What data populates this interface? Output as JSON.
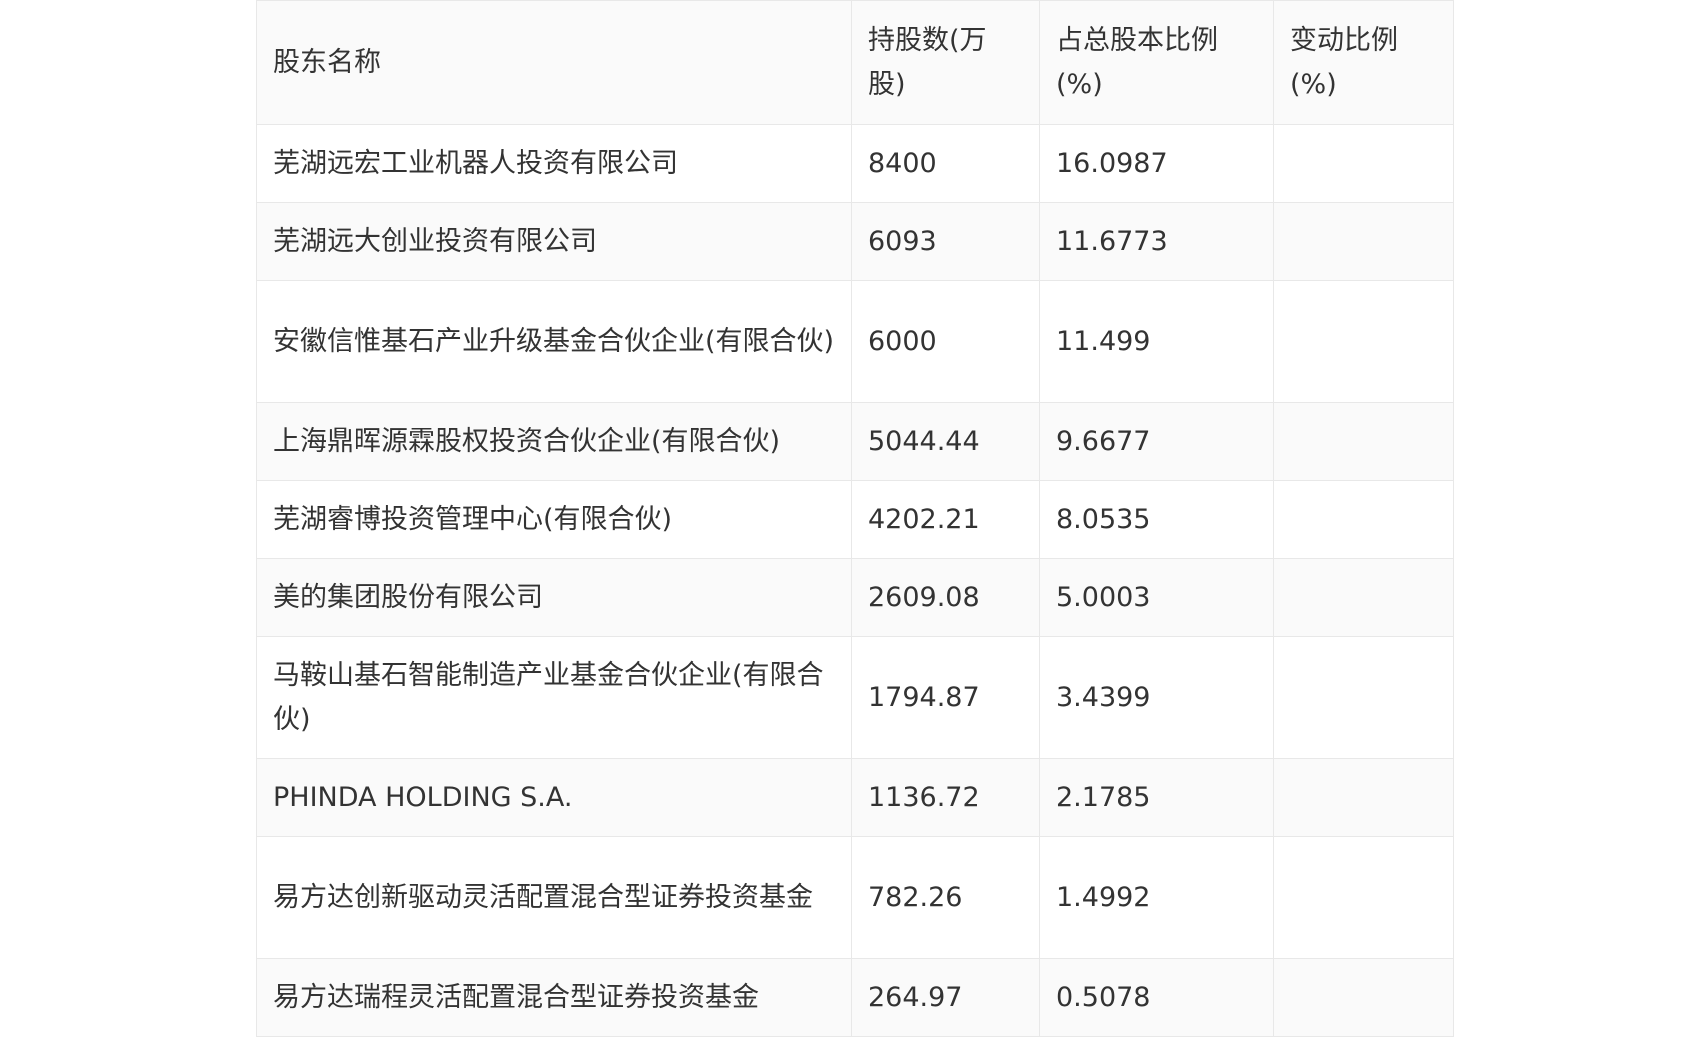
{
  "table": {
    "headers": [
      "股东名称",
      "持股数(万股)",
      "占总股本比例(%)",
      "变动比例(%)"
    ],
    "rows": [
      {
        "name": "芜湖远宏工业机器人投资有限公司",
        "shares": "8400",
        "ratio": "16.0987",
        "change": ""
      },
      {
        "name": "芜湖远大创业投资有限公司",
        "shares": "6093",
        "ratio": "11.6773",
        "change": ""
      },
      {
        "name": "安徽信惟基石产业升级基金合伙企业(有限合伙)",
        "shares": "6000",
        "ratio": "11.499",
        "change": ""
      },
      {
        "name": "上海鼎晖源霖股权投资合伙企业(有限合伙)",
        "shares": "5044.44",
        "ratio": "9.6677",
        "change": ""
      },
      {
        "name": "芜湖睿博投资管理中心(有限合伙)",
        "shares": "4202.21",
        "ratio": "8.0535",
        "change": ""
      },
      {
        "name": "美的集团股份有限公司",
        "shares": "2609.08",
        "ratio": "5.0003",
        "change": ""
      },
      {
        "name": "马鞍山基石智能制造产业基金合伙企业(有限合伙)",
        "shares": "1794.87",
        "ratio": "3.4399",
        "change": ""
      },
      {
        "name": "PHINDA HOLDING S.A.",
        "shares": "1136.72",
        "ratio": "2.1785",
        "change": ""
      },
      {
        "name": "易方达创新驱动灵活配置混合型证券投资基金",
        "shares": "782.26",
        "ratio": "1.4992",
        "change": ""
      },
      {
        "name": "易方达瑞程灵活配置混合型证券投资基金",
        "shares": "264.97",
        "ratio": "0.5078",
        "change": ""
      }
    ]
  }
}
